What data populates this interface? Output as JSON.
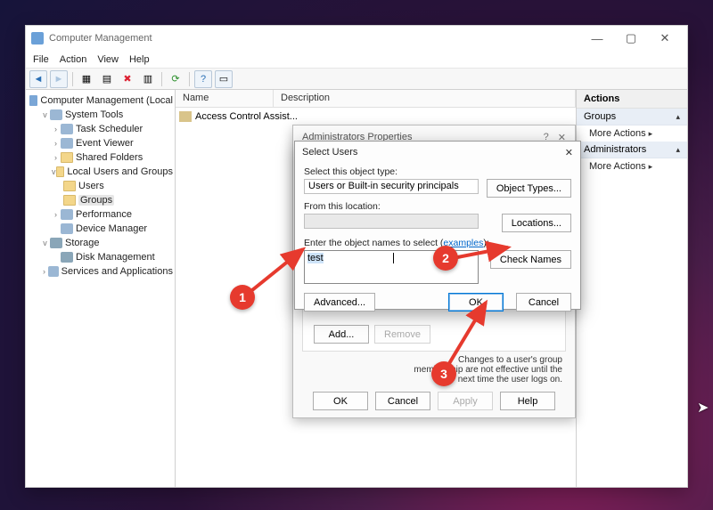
{
  "window": {
    "title": "Computer Management",
    "menu": [
      "File",
      "Action",
      "View",
      "Help"
    ],
    "controls": {
      "min": "—",
      "max": "▢",
      "close": "✕"
    }
  },
  "tree": {
    "root": "Computer Management (Local",
    "system_tools": "System Tools",
    "task_scheduler": "Task Scheduler",
    "event_viewer": "Event Viewer",
    "shared_folders": "Shared Folders",
    "local_users_groups": "Local Users and Groups",
    "users": "Users",
    "groups": "Groups",
    "performance": "Performance",
    "device_manager": "Device Manager",
    "storage": "Storage",
    "disk_management": "Disk Management",
    "services_apps": "Services and Applications"
  },
  "list": {
    "col_name": "Name",
    "col_desc": "Description",
    "row0": "Access Control Assist..."
  },
  "actions": {
    "header": "Actions",
    "sec1": "Groups",
    "more1": "More Actions",
    "sec2": "Administrators",
    "more2": "More Actions"
  },
  "dlg_props": {
    "title": "Administrators Properties",
    "help": "?",
    "close": "✕",
    "note": "Changes to a user's group membership are not effective until the next time the user logs on.",
    "add": "Add...",
    "remove": "Remove",
    "ok": "OK",
    "cancel": "Cancel",
    "apply": "Apply",
    "help_btn": "Help"
  },
  "dlg_select": {
    "title": "Select Users",
    "close": "✕",
    "lbl_objtype": "Select this object type:",
    "objtype": "Users or Built-in security principals",
    "btn_objtypes": "Object Types...",
    "lbl_location": "From this location:",
    "btn_locations": "Locations...",
    "lbl_names_pre": "Enter the object names to select (",
    "lbl_names_link": "examples",
    "lbl_names_post": "):",
    "entered": "test",
    "btn_checknames": "Check Names",
    "btn_advanced": "Advanced...",
    "ok": "OK",
    "cancel": "Cancel"
  },
  "annotations": {
    "n1": "1",
    "n2": "2",
    "n3": "3"
  }
}
